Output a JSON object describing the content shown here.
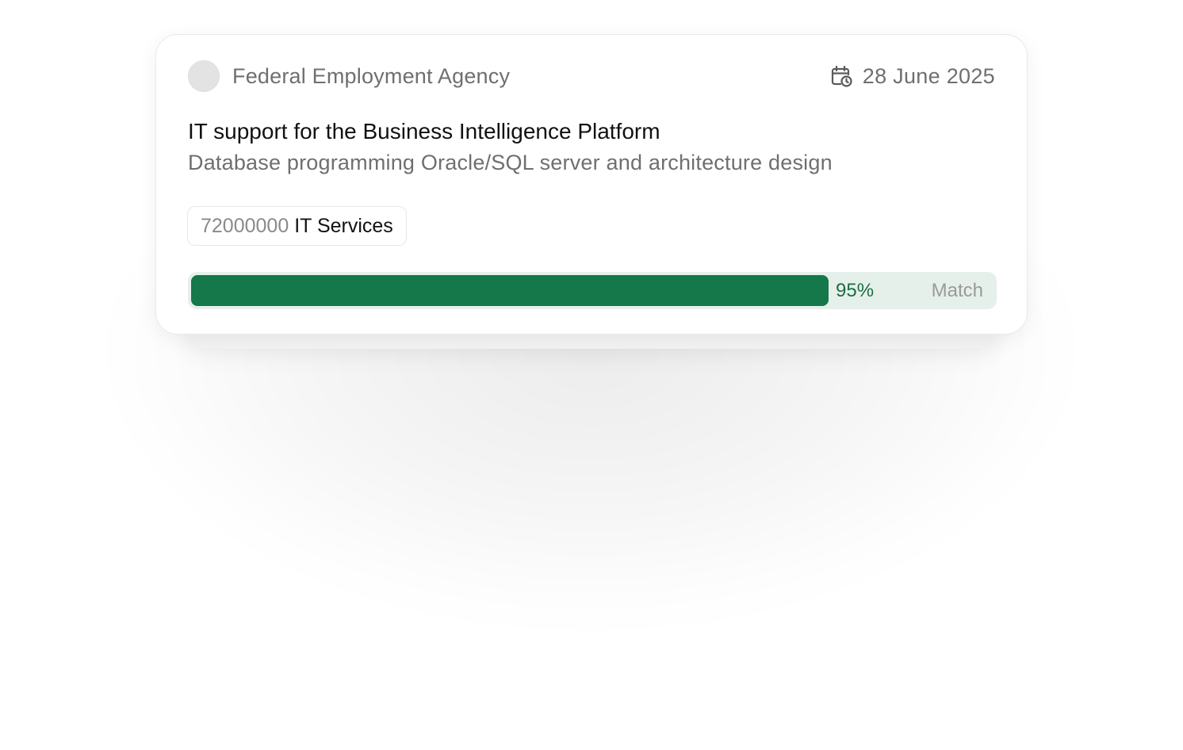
{
  "card": {
    "agency": "Federal Employment Agency",
    "date": "28 June 2025",
    "title": "IT support for the Business Intelligence Platform",
    "subtitle": "Database programming Oracle/SQL server and architecture design",
    "tag": {
      "code": "72000000",
      "label": "IT Services"
    },
    "match": {
      "value": 95,
      "percent_text": "95%",
      "label": "Match"
    },
    "icons": {
      "date": "calendar-clock-icon"
    },
    "colors": {
      "match_fill": "#14784a",
      "match_track": "#e6f0ea",
      "match_text": "#1b6d43"
    }
  }
}
